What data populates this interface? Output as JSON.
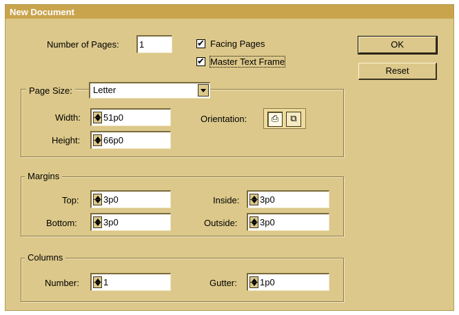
{
  "window": {
    "title": "New Document"
  },
  "top": {
    "pages_label": "Number of Pages:",
    "pages_value": "1",
    "facing_pages_label": "Facing Pages",
    "facing_pages_checked": true,
    "master_text_frame_label": "Master Text Frame",
    "master_text_frame_checked": true
  },
  "buttons": {
    "ok": "OK",
    "reset": "Reset"
  },
  "page_size": {
    "label": "Page Size:",
    "selected": "Letter",
    "width_label": "Width:",
    "width_value": "51p0",
    "height_label": "Height:",
    "height_value": "66p0",
    "orientation_label": "Orientation:",
    "orientation_selected": "portrait"
  },
  "margins": {
    "title": "Margins",
    "top_label": "Top:",
    "top_value": "3p0",
    "bottom_label": "Bottom:",
    "bottom_value": "3p0",
    "inside_label": "Inside:",
    "inside_value": "3p0",
    "outside_label": "Outside:",
    "outside_value": "3p0"
  },
  "columns": {
    "title": "Columns",
    "number_label": "Number:",
    "number_value": "1",
    "gutter_label": "Gutter:",
    "gutter_value": "1p0"
  },
  "colors": {
    "dialog_bg": "#dcc88a",
    "titlebar_bg": "#c9a44d"
  }
}
